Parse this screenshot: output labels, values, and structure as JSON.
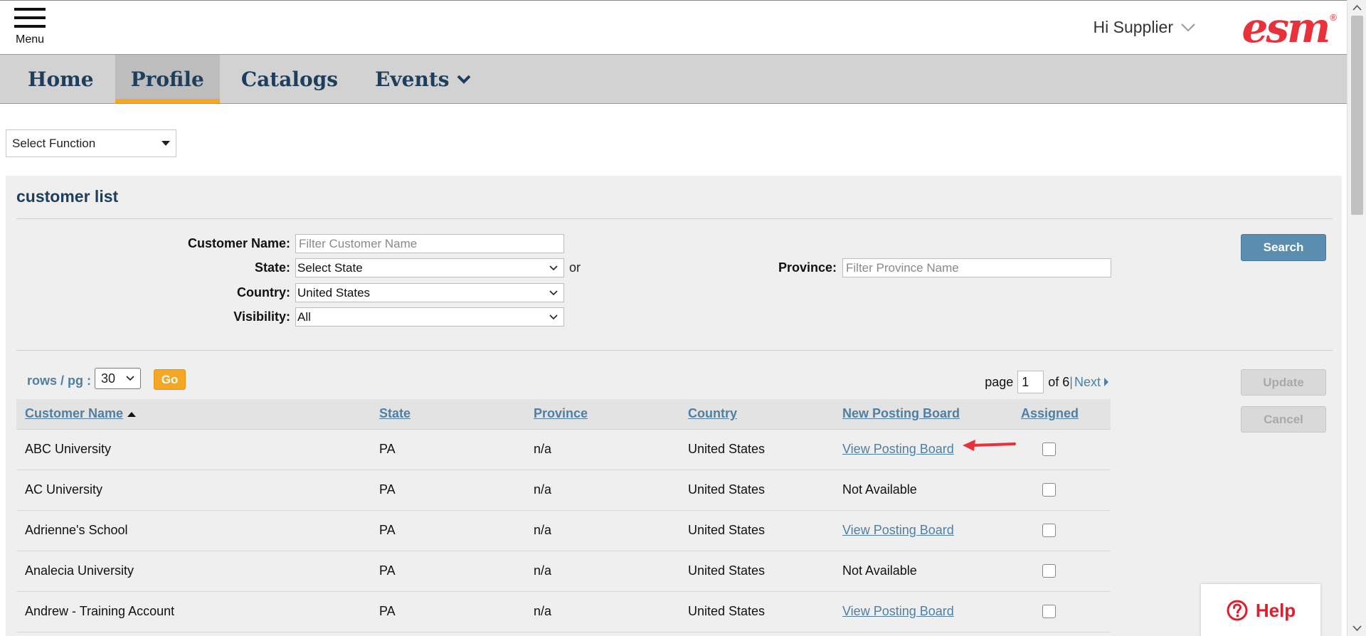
{
  "header": {
    "menu_label": "Menu",
    "greeting": "Hi Supplier",
    "logo_text": "esm",
    "logo_mark": "®",
    "logo_color": "#e8313b"
  },
  "nav": {
    "items": [
      {
        "label": "Home",
        "active": false
      },
      {
        "label": "Profile",
        "active": true
      },
      {
        "label": "Catalogs",
        "active": false
      },
      {
        "label": "Events",
        "active": false,
        "has_dropdown": true
      }
    ],
    "active_underline_color": "#f5a623"
  },
  "function_select": {
    "value": "Select Function"
  },
  "panel": {
    "title": "customer list"
  },
  "filters": {
    "customer_name_label": "Customer Name:",
    "customer_name_placeholder": "Filter Customer Name",
    "state_label": "State:",
    "state_value": "Select State",
    "or_text": "or",
    "province_label": "Province:",
    "province_placeholder": "Filter Province Name",
    "country_label": "Country:",
    "country_value": "United States",
    "visibility_label": "Visibility:",
    "visibility_value": "All"
  },
  "buttons": {
    "search": "Search",
    "update": "Update",
    "cancel": "Cancel",
    "go": "Go"
  },
  "pagination": {
    "rows_label": "rows / pg :",
    "rows_value": "30",
    "page_label": "page",
    "page_value": "1",
    "of_text": "of 6",
    "separator": "|",
    "next": "Next"
  },
  "table": {
    "columns": [
      "Customer Name",
      "State",
      "Province",
      "Country",
      "New Posting Board",
      "Assigned"
    ],
    "rows": [
      {
        "name": "ABC University",
        "state": "PA",
        "province": "n/a",
        "country": "United States",
        "posting_board": "View Posting Board",
        "posting_link": true,
        "assigned": false
      },
      {
        "name": "AC University",
        "state": "PA",
        "province": "n/a",
        "country": "United States",
        "posting_board": "Not Available",
        "posting_link": false,
        "assigned": false
      },
      {
        "name": "Adrienne's School",
        "state": "PA",
        "province": "n/a",
        "country": "United States",
        "posting_board": "View Posting Board",
        "posting_link": true,
        "assigned": false
      },
      {
        "name": "Analecia University",
        "state": "PA",
        "province": "n/a",
        "country": "United States",
        "posting_board": "Not Available",
        "posting_link": false,
        "assigned": false
      },
      {
        "name": "Andrew - Training Account",
        "state": "PA",
        "province": "n/a",
        "country": "United States",
        "posting_board": "View Posting Board",
        "posting_link": true,
        "assigned": false
      }
    ]
  },
  "help": {
    "label": "Help",
    "icon": "question-circle-icon",
    "color": "#e01e2b"
  },
  "annotation": {
    "icon": "red-arrow-icon",
    "color": "#e8313b"
  }
}
